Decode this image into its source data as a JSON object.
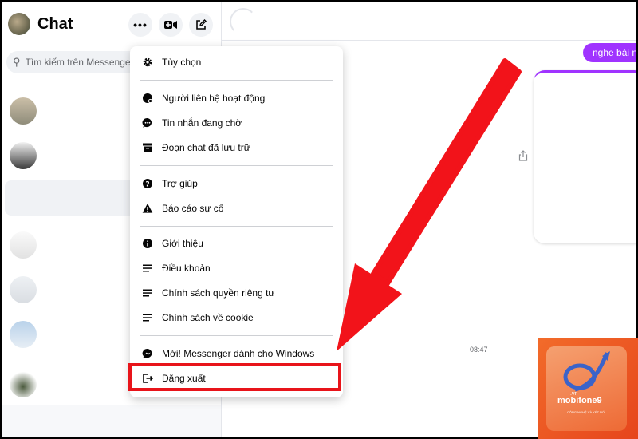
{
  "sidebar": {
    "title": "Chat",
    "more_icon": "ellipsis-icon",
    "video_icon": "video-camera-icon",
    "compose_icon": "compose-icon",
    "search_placeholder": "Tìm kiếm trên Messenger"
  },
  "menu": {
    "items": [
      {
        "label": "Tùy chọn",
        "icon": "gear-icon"
      },
      {
        "label": "Người liên hệ hoạt động",
        "icon": "active-contacts-icon"
      },
      {
        "label": "Tin nhắn đang chờ",
        "icon": "message-bubble-icon"
      },
      {
        "label": "Đoạn chat đã lưu trữ",
        "icon": "archive-box-icon"
      },
      {
        "label": "Trợ giúp",
        "icon": "question-circle-icon"
      },
      {
        "label": "Báo cáo sự cố",
        "icon": "warning-triangle-icon"
      },
      {
        "label": "Giới thiệu",
        "icon": "info-circle-icon"
      },
      {
        "label": "Điều khoản",
        "icon": "lines-icon"
      },
      {
        "label": "Chính sách quyền riêng tư",
        "icon": "lines-icon"
      },
      {
        "label": "Chính sách về cookie",
        "icon": "lines-icon"
      },
      {
        "label": "Mới! Messenger dành cho Windows",
        "icon": "messenger-logo-icon"
      },
      {
        "label": "Đăng xuất",
        "icon": "logout-icon"
      }
    ]
  },
  "chat": {
    "bubble_text": "nghe bài nà",
    "time": "08:47"
  },
  "logo": {
    "brand": "mobifone9",
    "vn": ".vn",
    "tagline": "CÔNG NGHỆ VÀ KẾT NỐI"
  },
  "colors": {
    "accent_purple": "#a033ff",
    "highlight_red": "#e8141a",
    "arrow_red": "#f2131a"
  }
}
